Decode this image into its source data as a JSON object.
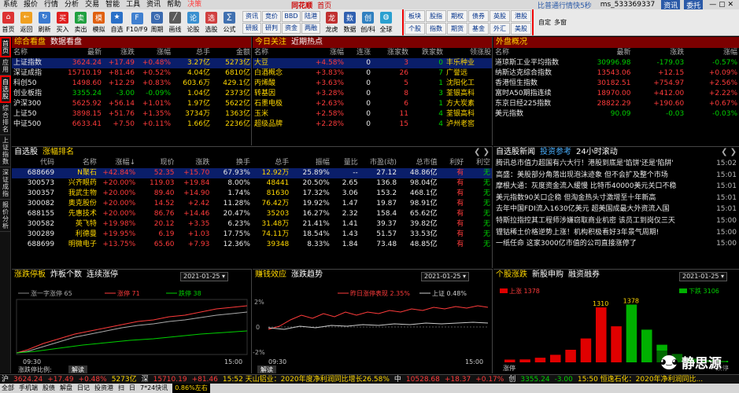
{
  "menu": {
    "items": [
      "系统",
      "报价",
      "行情",
      "分析",
      "交易",
      "智能",
      "工具",
      "资讯",
      "帮助",
      "决策"
    ],
    "brand": "同花顺",
    "title": "首页",
    "account": "比普通行情快5秒",
    "user": "ms_533369337",
    "news_btn": "资讯",
    "login_btn": "委托"
  },
  "toolbar": {
    "buttons": [
      "首页",
      "返回",
      "刷新",
      "买入",
      "卖出",
      "模拟",
      "自选",
      "F10/F9",
      "周期",
      "画线",
      "论股",
      "选股",
      "公式",
      "个股",
      "综合",
      "BBD",
      "陆港",
      "沪港",
      "龙虎",
      "数据",
      "创/科",
      "全球"
    ],
    "grid_a": [
      "资讯",
      "竞价",
      "BBD",
      "陆港",
      "研报",
      "研判",
      "资金",
      "两融"
    ],
    "grid_b": [
      "板块",
      "股指",
      "期权",
      "债券",
      "英股",
      "港股",
      "个股",
      "指数",
      "期货",
      "基金",
      "外汇",
      "美股"
    ],
    "extra": [
      "自定",
      "多窗"
    ]
  },
  "sidebar": [
    "首页",
    "应用",
    "自选股",
    "综合排名",
    "上证指数",
    "深证成指",
    "报价分析"
  ],
  "indices_panel": {
    "title": "综合看盘",
    "subtitle": "数据看盘",
    "headers": [
      "名称",
      "最新",
      "涨跌",
      "涨幅",
      "总手",
      "金额"
    ],
    "rows": [
      [
        "上证指数",
        "3624.24",
        "+17.49",
        "+0.48%",
        "3.27亿",
        "5273亿"
      ],
      [
        "深证成指",
        "15710.19",
        "+81.46",
        "+0.52%",
        "4.04亿",
        "6810亿"
      ],
      [
        "科创50",
        "1498.60",
        "+12.29",
        "+0.83%",
        "603.6万",
        "429.1亿"
      ],
      [
        "创业板指",
        "3355.24",
        "-3.00",
        "-0.09%",
        "1.04亿",
        "2373亿"
      ],
      [
        "沪深300",
        "5625.92",
        "+56.14",
        "+1.01%",
        "1.97亿",
        "5622亿"
      ],
      [
        "上证50",
        "3898.15",
        "+51.76",
        "+1.35%",
        "3734万",
        "1363亿"
      ],
      [
        "中证500",
        "6633.41",
        "+7.50",
        "+0.11%",
        "1.66亿",
        "2236亿"
      ]
    ]
  },
  "hot_panel": {
    "title": "今日关注",
    "subtitle": "近期热点",
    "headers": [
      "名称",
      "涨幅",
      "连涨",
      "涨家数",
      "跌家数",
      "领涨股"
    ],
    "rows": [
      [
        "大豆",
        "+4.58%",
        "0",
        "3",
        "0",
        "丰乐种业"
      ],
      [
        "白酒概念",
        "+3.83%",
        "0",
        "26",
        "7",
        "广誉远"
      ],
      [
        "丙烯酸",
        "+3.63%",
        "0",
        "5",
        "1",
        "沈阳化工"
      ],
      [
        "转基因",
        "+3.28%",
        "0",
        "8",
        "3",
        "荃银高科"
      ],
      [
        "石墨电极",
        "+2.63%",
        "0",
        "6",
        "1",
        "方大炭素"
      ],
      [
        "玉米",
        "+2.58%",
        "0",
        "11",
        "4",
        "荃银高科"
      ],
      [
        "超级品牌",
        "+2.28%",
        "0",
        "15",
        "4",
        "泸州老窖"
      ]
    ]
  },
  "global_panel": {
    "title": "外盘概况",
    "headers": [
      "名称",
      "最新",
      "涨跌",
      "涨幅"
    ],
    "rows": [
      [
        "道琼斯工业平均指数",
        "30996.98",
        "-179.03",
        "-0.57%"
      ],
      [
        "纳斯达克综合指数",
        "13543.06",
        "+12.15",
        "+0.09%"
      ],
      [
        "香港恒生指数",
        "30182.51",
        "+754.97",
        "+2.56%"
      ],
      [
        "富时A50期指连续",
        "18970.00",
        "+412.00",
        "+2.22%"
      ],
      [
        "东京日经225指数",
        "28822.29",
        "+190.60",
        "+0.67%"
      ],
      [
        "美元指数",
        "90.09",
        "-0.03",
        "-0.03%"
      ]
    ]
  },
  "watch_panel": {
    "title": "自选股",
    "subtitle": "涨幅排名",
    "headers": [
      "代码",
      "名称",
      "涨幅↓",
      "现价",
      "涨跌",
      "换手",
      "总手",
      "振幅",
      "量比",
      "市盈(动)",
      "总市值",
      "利好",
      "利空"
    ],
    "rows": [
      [
        "688669",
        "N聚石",
        "+42.84%",
        "52.35",
        "+15.70",
        "67.93%",
        "12.92万",
        "25.89%",
        "--",
        "27.12",
        "48.86亿",
        "有",
        "无"
      ],
      [
        "300573",
        "兴齐眼药",
        "+20.00%",
        "119.03",
        "+19.84",
        "8.00%",
        "48441",
        "20.50%",
        "2.65",
        "136.8",
        "98.04亿",
        "有",
        "无"
      ],
      [
        "300357",
        "我武生物",
        "+20.00%",
        "89.40",
        "+14.90",
        "1.74%",
        "81630",
        "17.32%",
        "3.06",
        "153.2",
        "468.1亿",
        "有",
        "无"
      ],
      [
        "300082",
        "奥克股份",
        "+20.00%",
        "14.52",
        "+2.42",
        "11.28%",
        "76.42万",
        "19.92%",
        "1.47",
        "19.87",
        "98.91亿",
        "有",
        "无"
      ],
      [
        "688155",
        "先惠技术",
        "+20.00%",
        "86.76",
        "+14.46",
        "20.47%",
        "35203",
        "16.27%",
        "2.32",
        "158.4",
        "65.62亿",
        "有",
        "无"
      ],
      [
        "300582",
        "英飞特",
        "+19.98%",
        "20.12",
        "+3.35",
        "6.23%",
        "31.48万",
        "21.41%",
        "1.41",
        "39.37",
        "39.82亿",
        "有",
        "无"
      ],
      [
        "300289",
        "利德曼",
        "+19.95%",
        "6.19",
        "+1.03",
        "17.75%",
        "74.11万",
        "18.54%",
        "1.43",
        "51.57",
        "33.53亿",
        "有",
        "无"
      ],
      [
        "688699",
        "明微电子",
        "+13.75%",
        "65.60",
        "+7.93",
        "12.36%",
        "39348",
        "8.33%",
        "1.84",
        "73.48",
        "48.85亿",
        "有",
        "无"
      ]
    ]
  },
  "news_panel": {
    "title": "自选股新闻",
    "subtitle": "投资参考",
    "subtitle2": "24小时滚动",
    "rows": [
      [
        "腾讯总市值力超国有六大行！港股到底是'馅饼'还是'陷阱'",
        "15:02"
      ],
      [
        "高盛：美股部分角落出现泡沫迹象 但不会扩及整个市场",
        "15:01"
      ],
      [
        "摩根大通：灰度资金流入缓慢 比特币40000美元关口不稳",
        "15:01"
      ],
      [
        "美元指数90关口企稳 但淘金热头寸激增至十年新高",
        "15:01"
      ],
      [
        "去年中国FDI流入1630亿美元 超美国成最大外资流入国",
        "15:01"
      ],
      [
        "特斯拉指控其工程师涉嫌窃取商业机密 该员工到岗仅三天",
        "15:00"
      ],
      [
        "锂钴稀土价格逆势上涨！机构积极看好3年景气周期!",
        "15:00"
      ],
      [
        "一纸任命 这家3000亿市值的公司直接涨停了",
        "15:00"
      ]
    ]
  },
  "chart1": {
    "title": "涨跌停板",
    "t2": "炸板个数",
    "t3": "连续涨停",
    "date": "2021-01-25",
    "legend": [
      "涨一字涨停 65",
      "涨停 71",
      "跌停 38"
    ],
    "time_start": "09:30",
    "time_end": "15:00",
    "footer": "涨跌停比例:",
    "footer_tab": "解读"
  },
  "chart2": {
    "title": "赚钱效应",
    "t2": "涨跌趋势",
    "date": "2021-01-25",
    "legend": [
      "昨日涨停表现 2.35%",
      "上证 0.48%"
    ],
    "y_top": "2%",
    "y_mid": "0",
    "y_bot": "-2%",
    "time_start": "09:30",
    "time_end": "15:00",
    "footer_tab": "解读"
  },
  "chart3": {
    "title": "个股涨跌",
    "t2": "新股申购",
    "t3": "融资融券",
    "date": "2021-01-25",
    "legend": [
      "上涨 1378",
      "下跌 3106"
    ],
    "bars": [
      {
        "label": "涨停",
        "value": 65
      },
      {
        "label": "",
        "value": 70
      },
      {
        "label": "",
        "value": 110
      },
      {
        "label": "",
        "value": 180
      },
      {
        "label": "",
        "value": 300
      },
      {
        "label": "",
        "value": 570
      },
      {
        "label": "",
        "value": 1310
      },
      {
        "label": "",
        "value": 860
      },
      {
        "label": "",
        "value": 1378
      },
      {
        "label": "",
        "value": 780
      },
      {
        "label": "",
        "value": 420
      },
      {
        "label": "",
        "value": 200
      },
      {
        "label": "",
        "value": 90
      },
      {
        "label": "",
        "value": 60
      },
      {
        "label": "跌停",
        "value": 38
      }
    ],
    "up_colors": "#e00000",
    "down_colors": "#00b000",
    "peak_label": "1378",
    "peak2": "1310",
    "ymax": 1500
  },
  "status": {
    "segments": [
      [
        "沪",
        "3624.24",
        "+17.49",
        "+0.48%",
        "5273亿"
      ],
      [
        "深",
        "15710.19",
        "+81.46"
      ]
    ],
    "ticker1": "15:52 天山铝业：2020年度净利润同比增长26.58%",
    "chip1": "中",
    "chip1v": "10528.68",
    "chip1c": "+18.37",
    "chip1p": "+0.17%",
    "chip2": "创",
    "chip2v": "3355.24",
    "chip2c": "-3.00",
    "ticker2": "15:50 恒逸石化：2020年净利润同比..."
  },
  "bottom": {
    "items": [
      "全部",
      "手机端",
      "股债",
      "解盘",
      "日记",
      "投资港",
      "扫",
      "日",
      "7*24快讯"
    ],
    "alert": "0.86%左右"
  },
  "watermark": {
    "text": "静思源"
  }
}
